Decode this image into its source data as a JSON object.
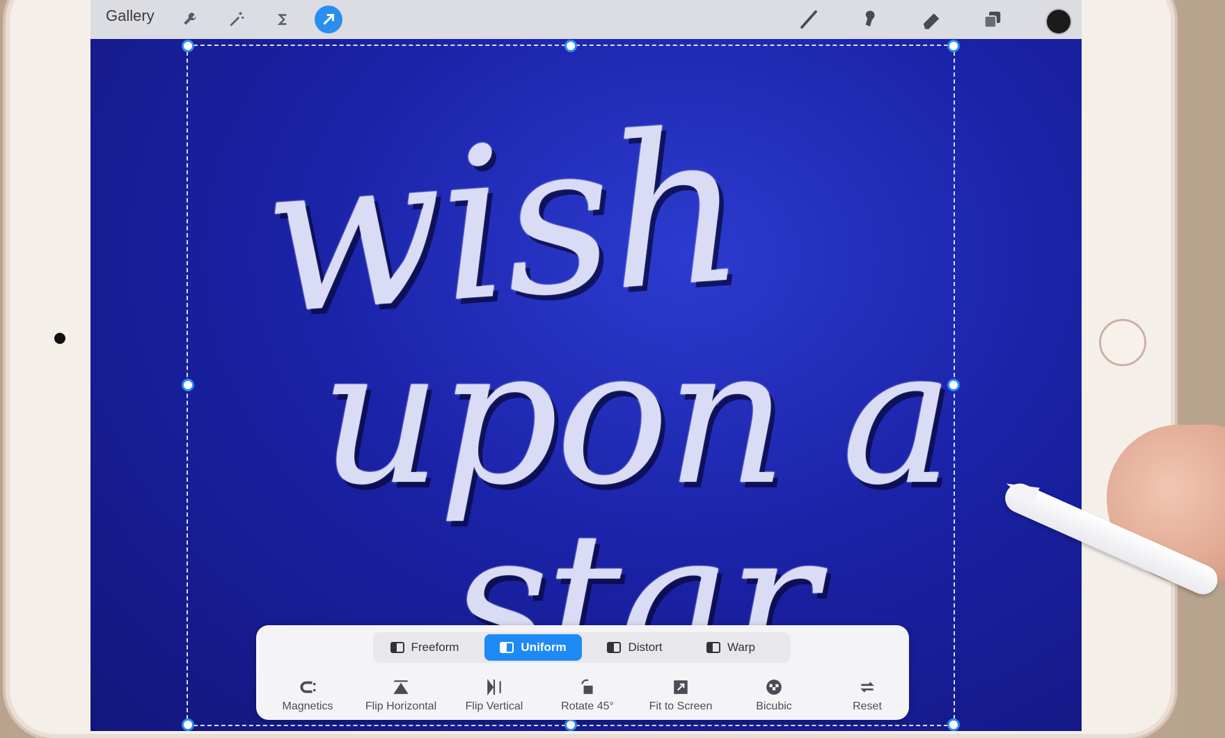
{
  "app": {
    "gallery_label": "Gallery"
  },
  "toolbar": {
    "left_tools": [
      {
        "name": "actions",
        "icon": "wrench-icon"
      },
      {
        "name": "adjustments",
        "icon": "magic-wand-icon"
      },
      {
        "name": "selection",
        "icon": "selection-s-icon"
      },
      {
        "name": "transform",
        "icon": "arrow-cursor-icon",
        "active": true
      }
    ],
    "right_tools": [
      {
        "name": "brush",
        "icon": "brush-icon"
      },
      {
        "name": "smudge",
        "icon": "smudge-icon"
      },
      {
        "name": "eraser",
        "icon": "eraser-icon"
      },
      {
        "name": "layers",
        "icon": "layers-icon"
      },
      {
        "name": "color",
        "icon": "color-well",
        "color": "#1b1b1b"
      }
    ],
    "accent_color": "#2a8df0"
  },
  "canvas": {
    "background_color": "#1a22a6",
    "lettering": [
      "wish",
      "upon a",
      "star"
    ]
  },
  "transform_panel": {
    "modes": [
      {
        "label": "Freeform",
        "active": false
      },
      {
        "label": "Uniform",
        "active": true
      },
      {
        "label": "Distort",
        "active": false
      },
      {
        "label": "Warp",
        "active": false
      }
    ],
    "actions": [
      {
        "label": "Magnetics",
        "icon": "magnet-icon"
      },
      {
        "label": "Flip Horizontal",
        "icon": "flip-horizontal-icon"
      },
      {
        "label": "Flip Vertical",
        "icon": "flip-vertical-icon"
      },
      {
        "label": "Rotate 45°",
        "icon": "rotate-icon"
      },
      {
        "label": "Fit to Screen",
        "icon": "fit-screen-icon"
      },
      {
        "label": "Bicubic",
        "icon": "bicubic-icon"
      },
      {
        "label": "Reset",
        "icon": "reset-icon"
      }
    ]
  }
}
